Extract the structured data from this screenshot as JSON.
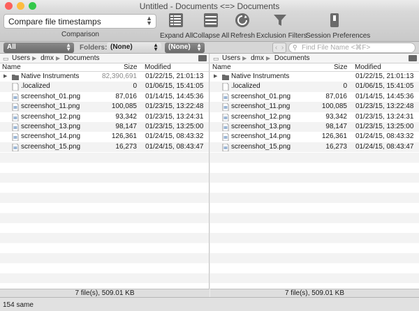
{
  "window": {
    "title": "Untitled - Documents <=> Documents"
  },
  "colors": {
    "close": "#fc605c",
    "minimize": "#fdbc40",
    "zoom": "#34c84a",
    "folder": "#6a6a6a"
  },
  "toolbar": {
    "comparison_value": "Compare file timestamps",
    "comparison_label": "Comparison",
    "buttons": [
      {
        "label": "Expand All",
        "icon": "expand-all-icon"
      },
      {
        "label": "Collapse All",
        "icon": "collapse-all-icon"
      },
      {
        "label": "Refresh",
        "icon": "refresh-icon"
      },
      {
        "label": "Exclusion Filters",
        "icon": "funnel-icon"
      },
      {
        "label": "Session Preferences",
        "icon": "switch-icon"
      }
    ]
  },
  "filterbar": {
    "display_filter": "All",
    "folders_label": "Folders:",
    "folders_value": "(None)",
    "right_value": "(None)",
    "search_placeholder": "Find File Name <⌘F>"
  },
  "columns": {
    "name": "Name",
    "size": "Size",
    "modified": "Modified"
  },
  "left": {
    "breadcrumb": [
      "Users",
      "dmx",
      "Documents"
    ],
    "footer": "7 file(s), 509.01 KB",
    "rows": [
      {
        "name": "Native Instruments",
        "size": "82,390,691",
        "modified": "01/22/15, 21:01:13",
        "type": "folder"
      },
      {
        "name": ".localized",
        "size": "0",
        "modified": "01/06/15, 15:41:05",
        "type": "file"
      },
      {
        "name": "screenshot_01.png",
        "size": "87,016",
        "modified": "01/14/15, 14:45:36",
        "type": "image"
      },
      {
        "name": "screenshot_11.png",
        "size": "100,085",
        "modified": "01/23/15, 13:22:48",
        "type": "image"
      },
      {
        "name": "screenshot_12.png",
        "size": "93,342",
        "modified": "01/23/15, 13:24:31",
        "type": "image"
      },
      {
        "name": "screenshot_13.png",
        "size": "98,147",
        "modified": "01/23/15, 13:25:00",
        "type": "image"
      },
      {
        "name": "screenshot_14.png",
        "size": "126,361",
        "modified": "01/24/15, 08:43:32",
        "type": "image"
      },
      {
        "name": "screenshot_15.png",
        "size": "16,273",
        "modified": "01/24/15, 08:43:47",
        "type": "image"
      }
    ]
  },
  "right": {
    "breadcrumb": [
      "Users",
      "dmx",
      "Documents"
    ],
    "footer": "7 file(s), 509.01 KB",
    "rows": [
      {
        "name": "Native Instruments",
        "size": "",
        "modified": "01/22/15, 21:01:13",
        "type": "folder"
      },
      {
        "name": ".localized",
        "size": "0",
        "modified": "01/06/15, 15:41:05",
        "type": "file"
      },
      {
        "name": "screenshot_01.png",
        "size": "87,016",
        "modified": "01/14/15, 14:45:36",
        "type": "image"
      },
      {
        "name": "screenshot_11.png",
        "size": "100,085",
        "modified": "01/23/15, 13:22:48",
        "type": "image"
      },
      {
        "name": "screenshot_12.png",
        "size": "93,342",
        "modified": "01/23/15, 13:24:31",
        "type": "image"
      },
      {
        "name": "screenshot_13.png",
        "size": "98,147",
        "modified": "01/23/15, 13:25:00",
        "type": "image"
      },
      {
        "name": "screenshot_14.png",
        "size": "126,361",
        "modified": "01/24/15, 08:43:32",
        "type": "image"
      },
      {
        "name": "screenshot_15.png",
        "size": "16,273",
        "modified": "01/24/15, 08:43:47",
        "type": "image"
      }
    ]
  },
  "status": {
    "text": "154 same"
  }
}
